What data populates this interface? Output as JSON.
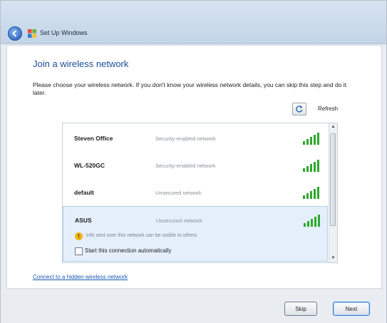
{
  "window": {
    "title": "Set Up Windows"
  },
  "page": {
    "heading": "Join a wireless network",
    "instructions": "Please choose your wireless network. If you don't know your wireless network details, you can skip this step and do it later."
  },
  "refresh": {
    "label": "Refresh"
  },
  "networks": [
    {
      "name": "Steven Office",
      "status": "Security-enabled network"
    },
    {
      "name": "WL-520GC",
      "status": "Security-enabled network"
    },
    {
      "name": "default",
      "status": "Unsecured network"
    },
    {
      "name": "ASUS",
      "status": "Unsecured network",
      "warning": "Info sent over this network can be visible to others",
      "auto_connect_label": "Start this connection automatically"
    }
  ],
  "hidden_network_link": "Connect to a hidden wireless network",
  "buttons": {
    "skip": "Skip",
    "next": "Next"
  },
  "colors": {
    "accent": "#1b4f9c",
    "signal": "#2fa82f",
    "warning": "#f2b515"
  }
}
